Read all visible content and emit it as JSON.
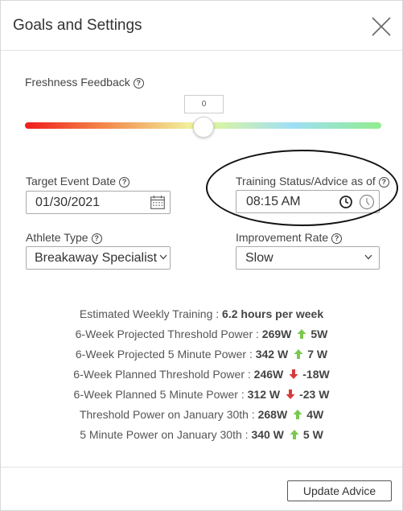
{
  "dialog": {
    "title": "Goals and Settings"
  },
  "freshness": {
    "label": "Freshness Feedback",
    "value": "0"
  },
  "target_event": {
    "label": "Target Event Date",
    "value": "01/30/2021"
  },
  "training_status": {
    "label": "Training Status/Advice as of",
    "value": "08:15 AM"
  },
  "athlete_type": {
    "label": "Athlete Type",
    "value": "Breakaway Specialist"
  },
  "improvement_rate": {
    "label": "Improvement Rate",
    "value": "Slow"
  },
  "stats": [
    {
      "label": "Estimated Weekly Training :",
      "value": "6.2 hours per week"
    },
    {
      "label": "6-Week Projected Threshold Power :",
      "value": "269W",
      "direction": "up",
      "delta": "5W"
    },
    {
      "label": "6-Week Projected 5 Minute Power :",
      "value": "342 W",
      "direction": "up",
      "delta": "7 W"
    },
    {
      "label": "6-Week Planned Threshold Power :",
      "value": "246W",
      "direction": "down",
      "delta": "-18W"
    },
    {
      "label": "6-Week Planned 5 Minute Power :",
      "value": "312 W",
      "direction": "down",
      "delta": "-23 W"
    },
    {
      "label": "Threshold Power on January 30th :",
      "value": "268W",
      "direction": "up",
      "delta": "4W"
    },
    {
      "label": "5 Minute Power on January 30th :",
      "value": "340 W",
      "direction": "up",
      "delta": "5 W"
    }
  ],
  "footer": {
    "update_button": "Update Advice"
  },
  "colors": {
    "arrow_up": "#79c94c",
    "arrow_down": "#d93a3a"
  }
}
